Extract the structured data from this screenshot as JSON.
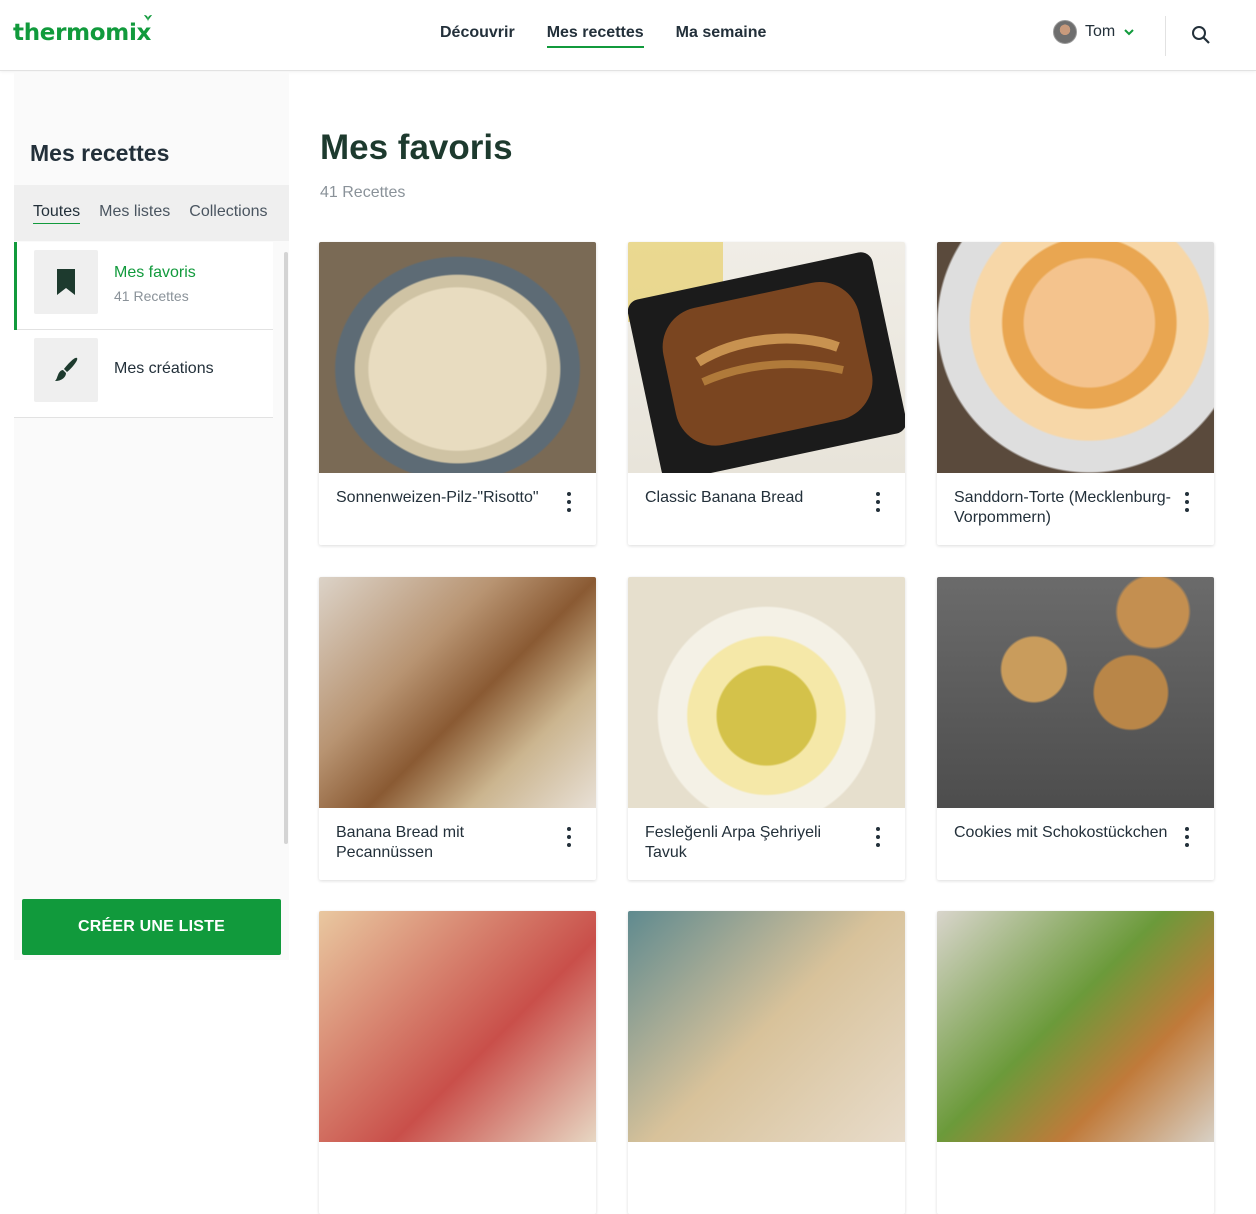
{
  "header": {
    "logo": "thermomix",
    "nav": [
      "Découvrir",
      "Mes recettes",
      "Ma semaine"
    ],
    "active_nav": "Mes recettes",
    "user_name": "Tom"
  },
  "sidebar": {
    "title": "Mes recettes",
    "tabs": [
      "Toutes",
      "Mes listes",
      "Collections"
    ],
    "active_tab": "Toutes",
    "items": [
      {
        "label": "Mes favoris",
        "sub": "41 Recettes",
        "icon": "bookmark-icon"
      },
      {
        "label": "Mes créations",
        "sub": "",
        "icon": "brush-icon"
      }
    ],
    "create_button": "CRÉER UNE LISTE"
  },
  "main": {
    "title": "Mes favoris",
    "count": "41 Recettes",
    "cards": [
      {
        "title": "Sonnenweizen-Pilz-\"Risotto\""
      },
      {
        "title": "Classic Banana Bread"
      },
      {
        "title": "Sanddorn-Torte (Mecklenburg-Vorpommern)"
      },
      {
        "title": "Banana Bread mit Pecannüssen"
      },
      {
        "title": "Fesleğenli Arpa Şehriyeli Tavuk"
      },
      {
        "title": "Cookies mit Schokostückchen"
      },
      {
        "title": ""
      },
      {
        "title": ""
      },
      {
        "title": ""
      }
    ]
  },
  "colors": {
    "brand": "#119a3c",
    "text": "#23303a",
    "muted": "#8a9299"
  }
}
